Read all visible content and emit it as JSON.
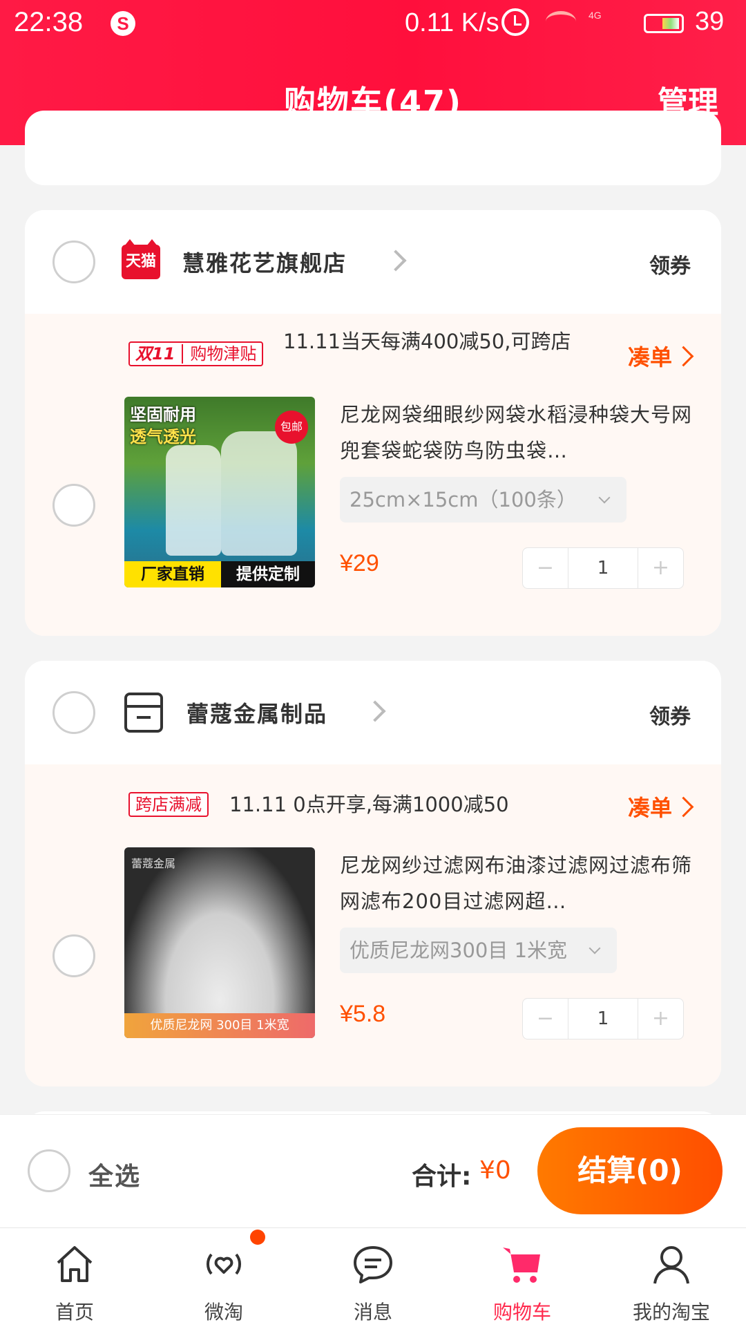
{
  "status_bar": {
    "time": "22:38",
    "network_speed": "0.11 K/s",
    "signal": "4G",
    "battery": "39"
  },
  "header": {
    "title": "购物车(47)",
    "manage": "管理"
  },
  "shops": [
    {
      "name": "慧雅花艺旗舰店",
      "badge": "天猫",
      "coupon": "领券",
      "promo_tag_main": "双11",
      "promo_tag_sub": "购物津贴",
      "promo_text": "11.11当天每满400减50,可跨店",
      "promo_link": "凑单",
      "item": {
        "title": "尼龙网袋细眼纱网袋水稻浸种袋大号网兜套袋蛇袋防鸟防虫袋…",
        "sku": "25cm×15cm（100条）",
        "price": "¥29",
        "qty": "1",
        "thumb_top1": "坚固耐用",
        "thumb_top2": "透气透光",
        "thumb_badge": "包邮",
        "thumb_bottom_left": "厂家直销",
        "thumb_bottom_right": "提供定制"
      }
    },
    {
      "name": "蕾蔻金属制品",
      "coupon": "领券",
      "promo_tag_main": "跨店满减",
      "promo_text": "11.11 0点开享,每满1000减50",
      "promo_link": "凑单",
      "item": {
        "title": "尼龙网纱过滤网布油漆过滤网过滤布筛网滤布200目过滤网超…",
        "sku": "优质尼龙网300目 1米宽",
        "price": "¥5.8",
        "qty": "1",
        "thumb_logo": "蕾蔻金属",
        "thumb_bottom": "优质尼龙网    300目   1米宽"
      }
    }
  ],
  "checkout": {
    "select_all": "全选",
    "total_label": "合计:",
    "total_value": "¥0",
    "button": "结算(0)"
  },
  "tabs": [
    {
      "label": "首页",
      "icon": "home-icon"
    },
    {
      "label": "微淘",
      "icon": "weitao-icon"
    },
    {
      "label": "消息",
      "icon": "message-icon"
    },
    {
      "label": "购物车",
      "icon": "cart-icon"
    },
    {
      "label": "我的淘宝",
      "icon": "profile-icon"
    }
  ],
  "colors": {
    "header": "#ff1a45",
    "price": "#ff5000",
    "checkout_button": "#ff5a00",
    "active_tab": "#ff2a4d"
  }
}
